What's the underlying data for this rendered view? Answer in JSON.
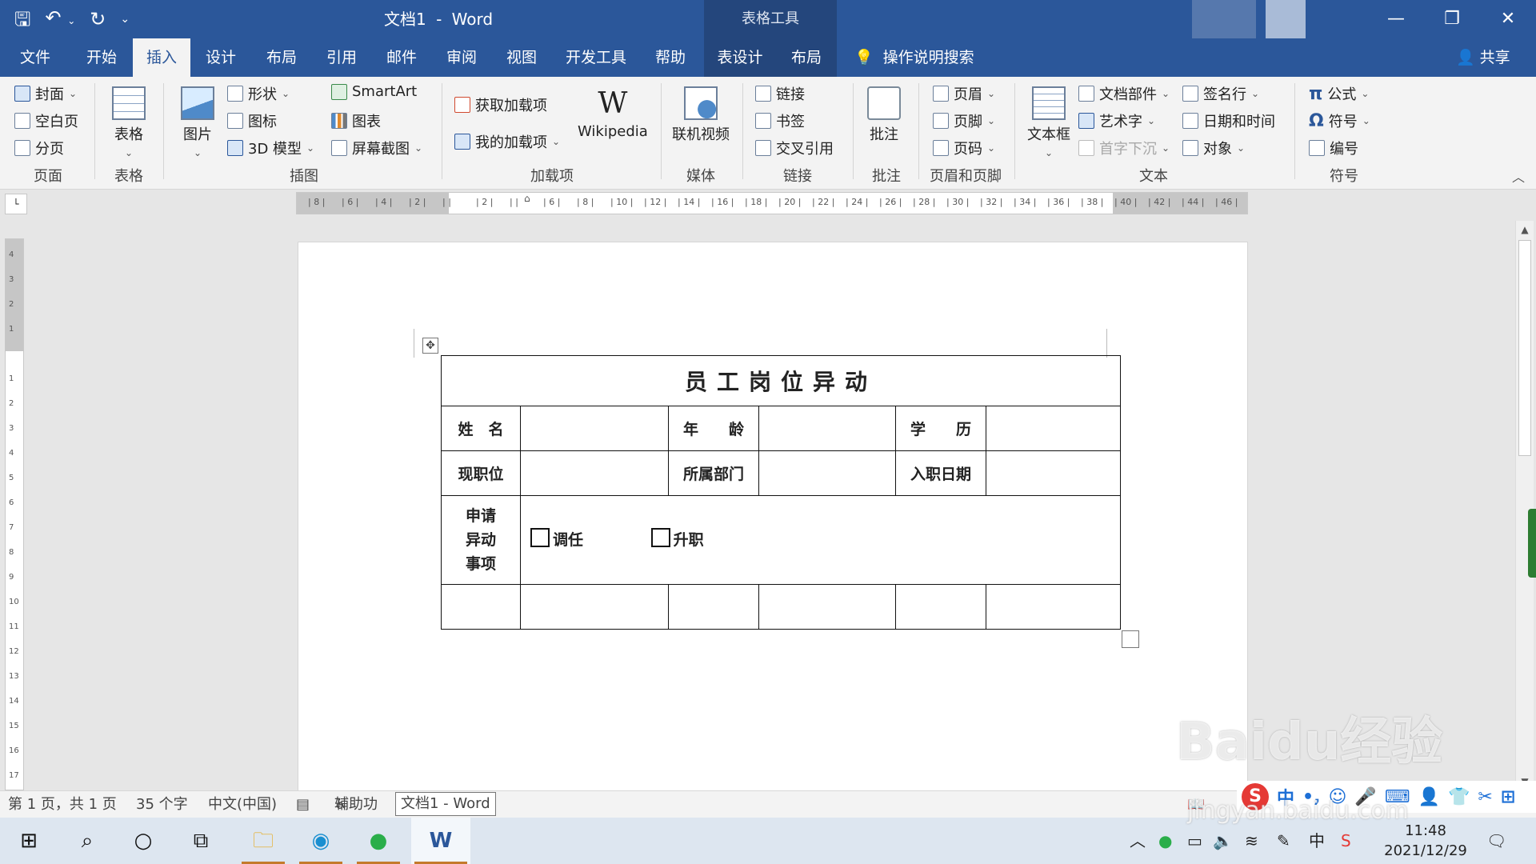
{
  "window": {
    "doc_name": "文档1",
    "separator": "-",
    "app_name": "Word",
    "context_tools": "表格工具"
  },
  "tabs": [
    {
      "label": "文件"
    },
    {
      "label": "开始"
    },
    {
      "label": "插入"
    },
    {
      "label": "设计"
    },
    {
      "label": "布局"
    },
    {
      "label": "引用"
    },
    {
      "label": "邮件"
    },
    {
      "label": "审阅"
    },
    {
      "label": "视图"
    },
    {
      "label": "开发工具"
    },
    {
      "label": "帮助"
    },
    {
      "label": "表设计"
    },
    {
      "label": "布局"
    }
  ],
  "tell_me": "操作说明搜索",
  "share": "共享",
  "ribbon": {
    "pages": {
      "label": "页面",
      "cover": "封面",
      "blank": "空白页",
      "break": "分页"
    },
    "tables": {
      "label": "表格",
      "table": "表格"
    },
    "illustrations": {
      "label": "插图",
      "picture": "图片",
      "shapes": "形状",
      "icons": "图标",
      "model3d": "3D 模型",
      "smartart": "SmartArt",
      "chart": "图表",
      "screenshot": "屏幕截图"
    },
    "addins": {
      "label": "加载项",
      "get": "获取加载项",
      "mine": "我的加载项",
      "wikipedia": "Wikipedia",
      "wiki_glyph": "W"
    },
    "media": {
      "label": "媒体",
      "video": "联机视频"
    },
    "links": {
      "label": "链接",
      "link": "链接",
      "bookmark": "书签",
      "crossref": "交叉引用"
    },
    "comments": {
      "label": "批注",
      "comment": "批注"
    },
    "header_footer": {
      "label": "页眉和页脚",
      "header": "页眉",
      "footer": "页脚",
      "page_number": "页码"
    },
    "text": {
      "label": "文本",
      "textbox": "文本框",
      "quickparts": "文档部件",
      "wordart": "艺术字",
      "dropcap": "首字下沉",
      "signature": "签名行",
      "datetime": "日期和时间",
      "object": "对象"
    },
    "symbols": {
      "label": "符号",
      "equation": "公式",
      "symbol": "符号",
      "number": "编号",
      "pi": "π",
      "omega": "Ω"
    }
  },
  "ruler": {
    "h_ticks": [
      "8",
      "6",
      "4",
      "2",
      "",
      "2",
      "",
      "6",
      "8",
      "10",
      "12",
      "14",
      "16",
      "18",
      "20",
      "22",
      "24",
      "26",
      "28",
      "30",
      "32",
      "34",
      "36",
      "38",
      "40",
      "42",
      "44",
      "46"
    ],
    "v_ticks": [
      "4",
      "3",
      "2",
      "1",
      "",
      "1",
      "2",
      "3",
      "4",
      "5",
      "6",
      "7",
      "8",
      "9",
      "10",
      "11",
      "12",
      "13",
      "14",
      "15",
      "16",
      "17"
    ]
  },
  "table": {
    "title": "员工岗位异动",
    "row1": [
      "姓　名",
      "",
      "年　　龄",
      "",
      "学　　历",
      ""
    ],
    "row2": [
      "现职位",
      "",
      "所属部门",
      "",
      "入职日期",
      ""
    ],
    "row3_label": [
      "申请",
      "异动",
      "事项"
    ],
    "option1": "调任",
    "option2": "升职"
  },
  "status": {
    "pages": "第 1 页，共 1 页",
    "words": "35 个字",
    "language": "中文(中国)",
    "accessibility": "辅助功",
    "tooltip": "文档1 - Word"
  },
  "taskbar": {
    "time": "11:48",
    "date": "2021/12/29",
    "ime": "中"
  },
  "watermark": {
    "main": "Baidu经验",
    "url": "jingyan.baidu.com"
  },
  "colors": {
    "word_blue": "#2b579a",
    "ribbon_bg": "#f3f3f3"
  }
}
